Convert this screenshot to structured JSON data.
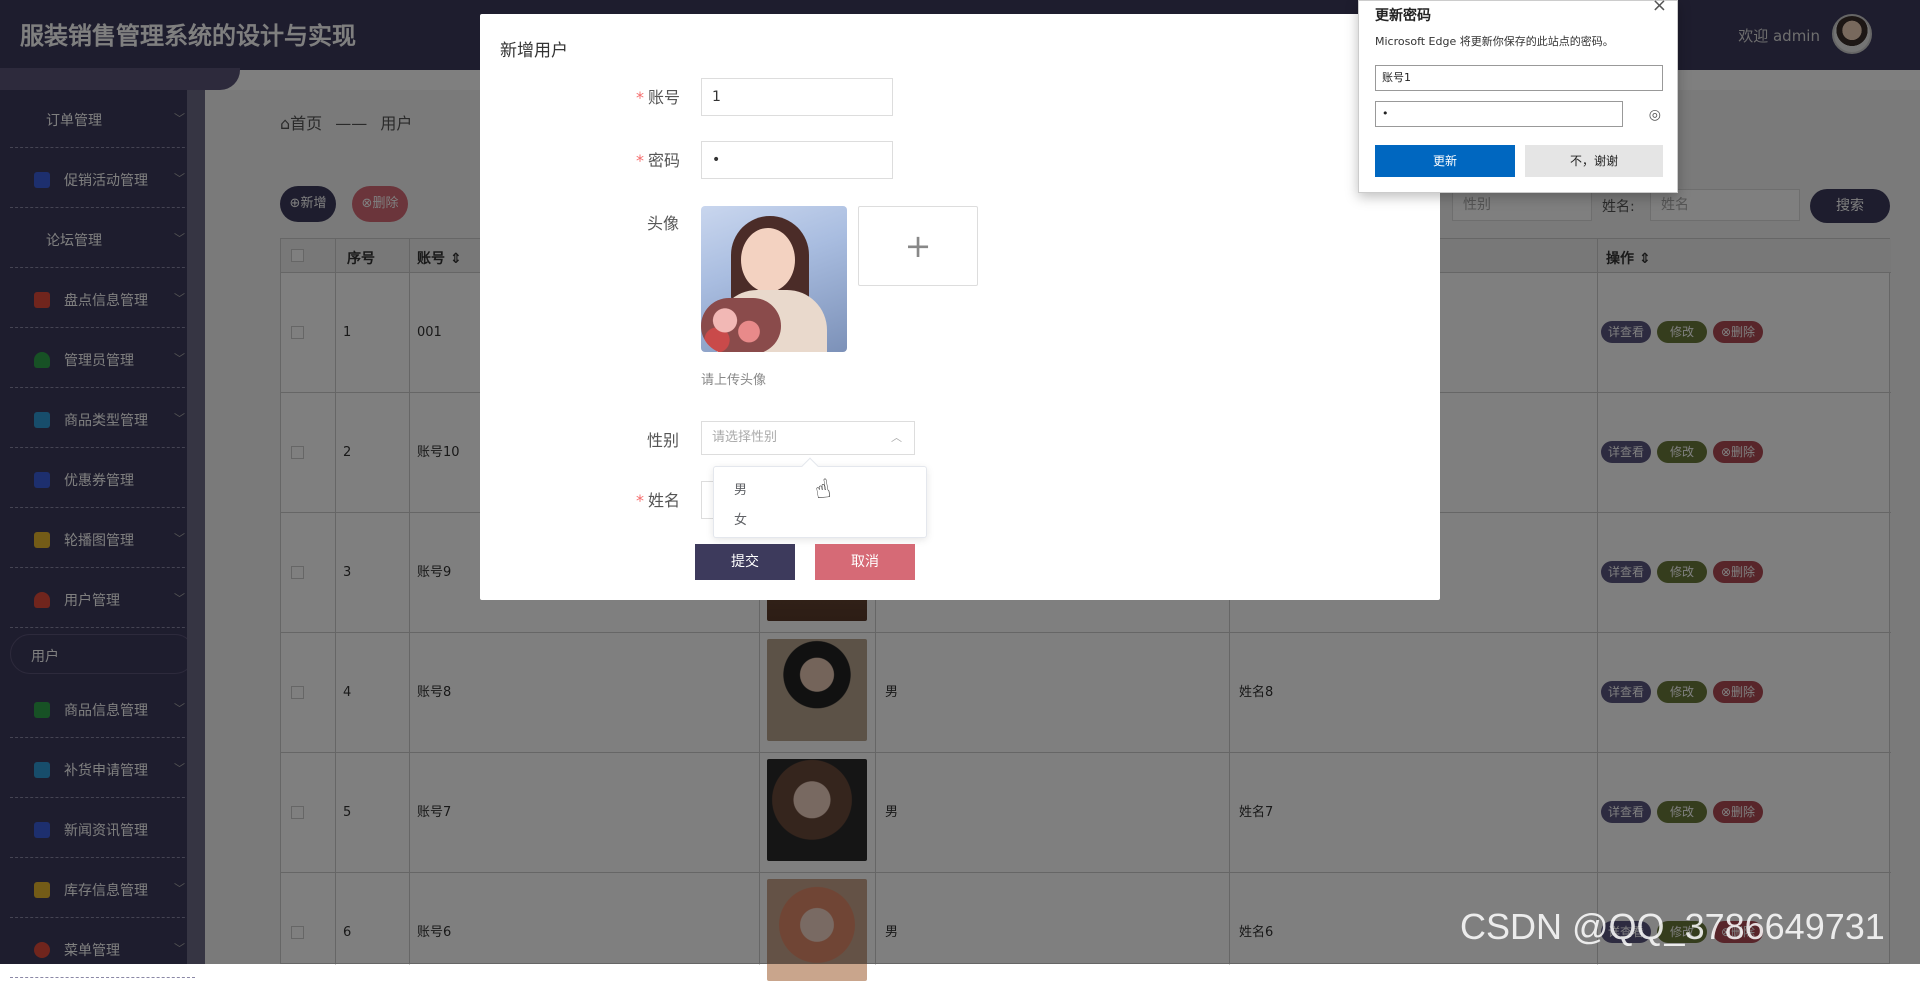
{
  "header": {
    "title": "服装销售管理系统的设计与实现",
    "welcome": "欢迎 admin"
  },
  "sidebar": {
    "items": [
      {
        "label": "订单管理",
        "icon": "none-icon",
        "color": ""
      },
      {
        "label": "促销活动管理",
        "icon": "grid-icon",
        "color": "#3b5fdc"
      },
      {
        "label": "论坛管理",
        "icon": "none-icon",
        "color": ""
      },
      {
        "label": "盘点信息管理",
        "icon": "box-icon",
        "color": "#e04b3a"
      },
      {
        "label": "管理员管理",
        "icon": "person-icon",
        "color": "#2fa24a"
      },
      {
        "label": "商品类型管理",
        "icon": "table-icon",
        "color": "#2e9bd6"
      },
      {
        "label": "优惠券管理",
        "icon": "coupon-icon",
        "color": "#3b5fdc"
      },
      {
        "label": "轮播图管理",
        "icon": "flower-icon",
        "color": "#e7b62f"
      },
      {
        "label": "用户管理",
        "icon": "person-icon",
        "color": "#e04b3a"
      },
      {
        "label": "商品信息管理",
        "icon": "folder-icon",
        "color": "#2fa24a"
      },
      {
        "label": "补货申请管理",
        "icon": "table-icon",
        "color": "#2e9bd6"
      },
      {
        "label": "新闻资讯管理",
        "icon": "news-icon",
        "color": "#3b5fdc"
      },
      {
        "label": "库存信息管理",
        "icon": "folder-icon",
        "color": "#e7b62f"
      },
      {
        "label": "菜单管理",
        "icon": "circle-icon",
        "color": "#e04b3a"
      }
    ],
    "sub_active": "用户"
  },
  "breadcrumb": {
    "home": "首页",
    "sep": "——",
    "current": "用户"
  },
  "toolbar": {
    "add": "⊕新增",
    "delete": "⊗删除"
  },
  "filter": {
    "gender_placeholder": "性别",
    "name_label": "姓名:",
    "name_placeholder": "姓名",
    "search": "搜索"
  },
  "table": {
    "headers": {
      "index": "序号",
      "account": "账号 ⇕",
      "ops": "操作 ⇕"
    },
    "rows": [
      {
        "index": "1",
        "account": "001",
        "gender": "",
        "name": ""
      },
      {
        "index": "2",
        "account": "账号10",
        "gender": "",
        "name": ""
      },
      {
        "index": "3",
        "account": "账号9",
        "gender": "",
        "name": ""
      },
      {
        "index": "4",
        "account": "账号8",
        "gender": "男",
        "name": "姓名8"
      },
      {
        "index": "5",
        "account": "账号7",
        "gender": "男",
        "name": "姓名7"
      },
      {
        "index": "6",
        "account": "账号6",
        "gender": "男",
        "name": "姓名6"
      }
    ],
    "ops": {
      "view": "详查看",
      "edit": "修改",
      "delete": "⊗删除"
    }
  },
  "dialog": {
    "title": "新增用户",
    "account_label": "账号",
    "account_value": "1",
    "password_label": "密码",
    "password_value": "•",
    "avatar_label": "头像",
    "upload_tip": "请上传头像",
    "gender_label": "性别",
    "gender_placeholder": "请选择性别",
    "gender_options": [
      "男",
      "女"
    ],
    "name_label": "姓名",
    "submit": "提交",
    "cancel": "取消"
  },
  "edge_popup": {
    "title": "更新密码",
    "desc": "Microsoft Edge 将更新你保存的此站点的密码。",
    "username": "账号1",
    "password": "•",
    "update": "更新",
    "no_thanks": "不，谢谢"
  },
  "watermark": "CSDN @QQ_3786649731"
}
